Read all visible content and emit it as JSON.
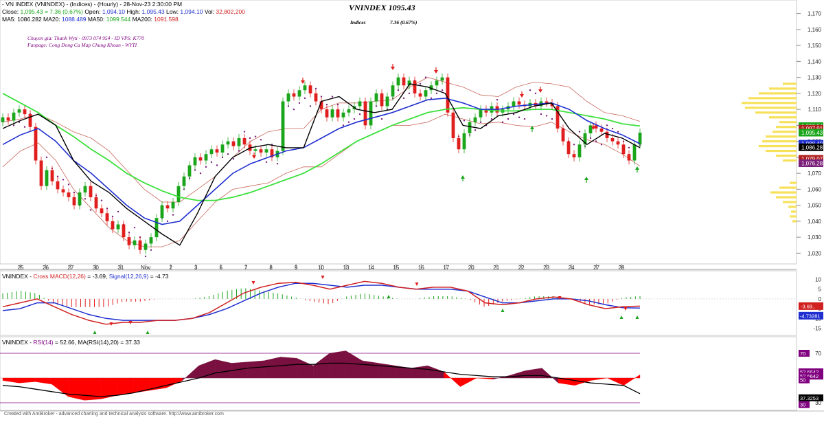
{
  "header": {
    "line1": {
      "name": "- VN INDEX (VNINDEX) -  (Indices) - (Hourly) - 28-Nov-23 2:30:00 PM",
      "close_label": "Close:",
      "close": "1,095.43",
      "change": "= 7.36 (0.67%)",
      "open_label": "Open:",
      "open": "1,094.10",
      "high_label": "High:",
      "high": "1,095.43",
      "low_label": "Low:",
      "low": "1,094.10",
      "vol_label": "Vol:",
      "vol": "32,802,200"
    },
    "line2": {
      "ma5_label": "MA5:",
      "ma5": "1086.282",
      "ma20_label": "MA20:",
      "ma20": "1088.489",
      "ma50_label": "MA50:",
      "ma50": "1099.544",
      "ma200_label": "MA200:",
      "ma200": "1091.598"
    },
    "big_title": "VNINDEX 1095.43",
    "indices_label": "Indices",
    "indices_change": "7.36 (0.67%)",
    "expert_line": "Chuyen gia: Thanh Wyti - 0973 074 954 - ID VPS: K770",
    "fanpage_line": "Fanpage: Cong Dong Ca Map Chung Khoan - WYTI"
  },
  "macd": {
    "title_name": "VNINDEX - ",
    "title_macd": "Cross MACD(12,26)",
    "macd_value": "= -3.69,",
    "title_signal": "Signal(12,26,9)",
    "signal_value": "= -4.73",
    "tick_labels": [
      "10",
      "5",
      "0",
      "-5",
      "-10",
      "-15"
    ],
    "value_boxes": [
      "-3.69..",
      "-4.73281"
    ]
  },
  "rsi": {
    "title_name": "VNINDEX - ",
    "title_rsi": "RSI(14)",
    "rsi_value": "= 52.66,",
    "title_ma": "MA(RSI(14),20)",
    "ma_value": "= 37.33",
    "tick_labels": [
      "70",
      "30"
    ],
    "value_boxes": [
      "70",
      "52.6642",
      "52.6642",
      "50",
      "37.3253",
      "30"
    ]
  },
  "footer": "Created with AmiBroker - advanced charting and technical analysis software. http://www.amibroker.com",
  "colors": {
    "bull": "#1aa51a",
    "bear": "#e01e1e",
    "ma5": "#000000",
    "ma20": "#1f2fd0",
    "ma50": "#3be03b",
    "bollinger": "#c8665a",
    "sar": "#7a1f7a",
    "rsi_fill": "#7a1040",
    "rsi_red": "#ff0000",
    "title_purple": "#800080"
  },
  "chart_data": [
    {
      "type": "candlestick",
      "title": "VNINDEX 1095.43",
      "ylim": [
        1015,
        1175
      ],
      "y_ticks": [
        1020,
        1030,
        1040,
        1050,
        1060,
        1070,
        1080,
        1090,
        1100,
        1110,
        1120,
        1130,
        1140,
        1150,
        1160,
        1170
      ],
      "x_ticks": [
        "25",
        "26",
        "27",
        "30",
        "31",
        "Nov",
        "2",
        "3",
        "6",
        "7",
        "8",
        "9",
        "10",
        "13",
        "14",
        "15",
        "16",
        "17",
        "20",
        "21",
        "22",
        "23",
        "24",
        "27",
        "28"
      ],
      "right_axis_boxes": [
        {
          "label": "1,099.54",
          "value": 1099.54,
          "color": "#1aa51a"
        },
        {
          "label": "1,097.91",
          "value": 1097.91,
          "color": "#b02020"
        },
        {
          "label": "1,095.43",
          "value": 1095.43,
          "color": "#1aa51a"
        },
        {
          "label": "1,088.49",
          "value": 1088.49,
          "color": "#1f2fd0"
        },
        {
          "label": "1,086.28",
          "value": 1086.28,
          "color": "#000000"
        },
        {
          "label": "1,079.07",
          "value": 1079.07,
          "color": "#b02020"
        },
        {
          "label": "1,076.28",
          "value": 1076.28,
          "color": "#7a1f7a"
        }
      ],
      "close": [
        1105,
        1103,
        1108,
        1110,
        1107,
        1099,
        1078,
        1062,
        1072,
        1065,
        1060,
        1058,
        1055,
        1050,
        1058,
        1062,
        1055,
        1048,
        1045,
        1040,
        1035,
        1038,
        1030,
        1025,
        1028,
        1022,
        1026,
        1030,
        1042,
        1050,
        1048,
        1052,
        1062,
        1068,
        1075,
        1080,
        1078,
        1082,
        1085,
        1083,
        1088,
        1090,
        1087,
        1092,
        1088,
        1084,
        1085,
        1083,
        1085,
        1080,
        1084,
        1115,
        1120,
        1118,
        1122,
        1125,
        1120,
        1115,
        1110,
        1105,
        1110,
        1105,
        1108,
        1110,
        1112,
        1115,
        1100,
        1115,
        1120,
        1112,
        1118,
        1125,
        1130,
        1125,
        1128,
        1120,
        1118,
        1122,
        1125,
        1128,
        1130,
        1108,
        1092,
        1085,
        1095,
        1102,
        1105,
        1110,
        1108,
        1112,
        1108,
        1110,
        1112,
        1115,
        1113,
        1112,
        1114,
        1112,
        1115,
        1114,
        1112,
        1098,
        1090,
        1082,
        1080,
        1088,
        1095,
        1100,
        1098,
        1096,
        1092,
        1090,
        1088,
        1082,
        1078,
        1088,
        1095.43
      ],
      "series": [
        {
          "name": "MA5",
          "values": [
            1098,
            1103,
            1107,
            1100,
            1078,
            1065,
            1058,
            1048,
            1040,
            1032,
            1025,
            1045,
            1068,
            1080,
            1086,
            1088,
            1086,
            1086,
            1115,
            1118,
            1110,
            1108,
            1110,
            1126,
            1124,
            1120,
            1100,
            1098,
            1106,
            1108,
            1112,
            1114,
            1098,
            1088,
            1095,
            1092,
            1086
          ]
        },
        {
          "name": "MA20",
          "values": [
            1088,
            1094,
            1098,
            1090,
            1078,
            1070,
            1060,
            1050,
            1042,
            1038,
            1040,
            1050,
            1060,
            1070,
            1076,
            1080,
            1084,
            1086,
            1092,
            1098,
            1102,
            1105,
            1108,
            1112,
            1116,
            1117,
            1114,
            1110,
            1110,
            1112,
            1113,
            1114,
            1110,
            1103,
            1098,
            1094,
            1088.49
          ]
        },
        {
          "name": "MA50",
          "values": [
            1120,
            1114,
            1108,
            1100,
            1093,
            1085,
            1078,
            1070,
            1064,
            1059,
            1055,
            1053,
            1053,
            1055,
            1058,
            1062,
            1066,
            1070,
            1076,
            1083,
            1090,
            1095,
            1100,
            1104,
            1108,
            1110,
            1111,
            1110,
            1109,
            1109,
            1110,
            1110,
            1108,
            1106,
            1104,
            1101,
            1099.54
          ]
        }
      ]
    },
    {
      "type": "line",
      "title": "Cross MACD(12,26)",
      "ylim": [
        -18,
        13
      ],
      "series": [
        {
          "name": "MACD",
          "values": [
            -4,
            -2,
            0,
            -4,
            -8,
            -11,
            -13,
            -12,
            -12,
            -11,
            -11,
            -10,
            -7,
            -2,
            3,
            6,
            8,
            8.5,
            7,
            5,
            7,
            9,
            8,
            6,
            5,
            6,
            6,
            4,
            -2,
            -3,
            -2,
            0,
            1,
            0,
            -3,
            -5,
            -4,
            -3.69
          ]
        },
        {
          "name": "Signal",
          "values": [
            -6,
            -5,
            -2,
            -2,
            -5,
            -8,
            -10,
            -11,
            -11,
            -11,
            -11,
            -10,
            -8,
            -5,
            -1,
            3,
            6,
            8,
            8,
            7,
            6,
            7,
            7,
            6,
            5,
            5,
            5,
            4,
            1,
            -2,
            -2,
            -1,
            0,
            0,
            -1,
            -3,
            -4.5,
            -4.73
          ]
        }
      ]
    },
    {
      "type": "area",
      "title": "RSI(14)",
      "ylim": [
        25,
        75
      ],
      "series": [
        {
          "name": "RSI(14)",
          "values": [
            48,
            46,
            47,
            45,
            35,
            32,
            33,
            36,
            38,
            40,
            42,
            48,
            60,
            65,
            62,
            63,
            64,
            67,
            66,
            60,
            70,
            72,
            64,
            62,
            60,
            58,
            60,
            55,
            43,
            50,
            49,
            52,
            56,
            58,
            46,
            44,
            48,
            50,
            44,
            52.66
          ]
        },
        {
          "name": "MA(RSI(14),20)",
          "values": [
            44,
            43,
            41,
            39,
            37,
            36,
            35,
            36,
            38,
            41,
            44,
            47,
            50,
            54,
            56,
            58,
            59,
            60,
            61,
            61,
            62,
            62,
            61,
            60,
            59,
            58,
            57,
            55,
            53,
            52,
            51,
            51,
            52,
            52,
            50,
            48,
            46,
            45,
            44,
            37.33
          ]
        }
      ]
    }
  ]
}
